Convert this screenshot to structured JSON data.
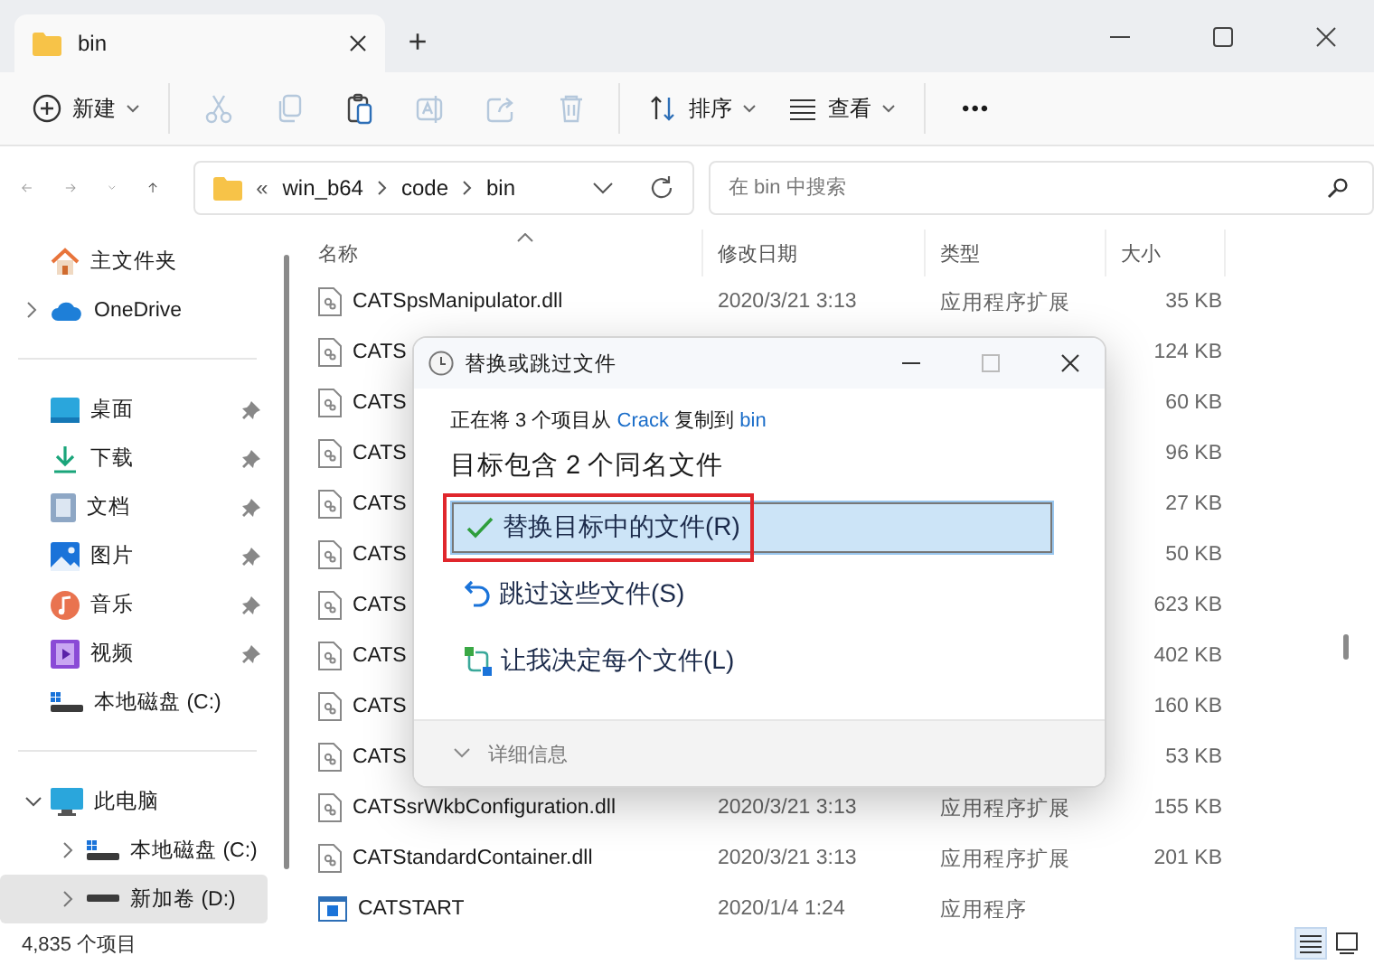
{
  "window": {
    "tabs": [
      {
        "label": "bin",
        "selected": true
      }
    ],
    "new_tab": "+"
  },
  "toolbar": {
    "new": "新建",
    "actions": [
      {
        "kind": "cut",
        "disabled": true
      },
      {
        "kind": "copy",
        "disabled": true
      },
      {
        "kind": "paste",
        "disabled": false
      },
      {
        "kind": "rename",
        "disabled": true
      },
      {
        "kind": "share",
        "disabled": true
      },
      {
        "kind": "delete",
        "disabled": true
      }
    ],
    "sort": "排序",
    "view": "查看",
    "more": "•••"
  },
  "address": {
    "overflow": "«",
    "path": [
      "win_b64",
      "code",
      "bin"
    ],
    "search_placeholder": "在 bin 中搜索"
  },
  "sidebar": {
    "groups": [
      [
        {
          "label": "主文件夹",
          "kind": "home",
          "selected": false
        },
        {
          "label": "OneDrive",
          "kind": "cloud",
          "selected": false,
          "expanded": false
        }
      ],
      [
        {
          "label": "桌面",
          "kind": "desktop",
          "pinned": true,
          "selected": false
        },
        {
          "label": "下载",
          "kind": "download",
          "pinned": true,
          "selected": false
        },
        {
          "label": "文档",
          "kind": "document",
          "pinned": true,
          "selected": false
        },
        {
          "label": "图片",
          "kind": "pictures",
          "pinned": true,
          "selected": false
        },
        {
          "label": "音乐",
          "kind": "music",
          "pinned": true,
          "selected": false
        },
        {
          "label": "视频",
          "kind": "video",
          "pinned": true,
          "selected": false
        },
        {
          "label": "本地磁盘 (C:)",
          "kind": "system-drive",
          "selected": false
        }
      ],
      [
        {
          "label": "此电脑",
          "kind": "computer",
          "selected": false,
          "expanded": true,
          "children": [
            {
              "label": "本地磁盘 (C:)",
              "kind": "system-drive",
              "selected": false,
              "expanded": false
            },
            {
              "label": "新加卷 (D:)",
              "kind": "drive",
              "selected": true,
              "expanded": false
            }
          ]
        }
      ]
    ]
  },
  "table": {
    "columns": [
      "名称",
      "修改日期",
      "类型",
      "大小"
    ],
    "rows": [
      {
        "kind": "dll",
        "name": "CATSpsManipulator.dll",
        "date": "2020/3/21 3:13",
        "type": "应用程序扩展",
        "size": "35 KB"
      },
      {
        "kind": "dll",
        "name": "CATS",
        "size": "124 KB"
      },
      {
        "kind": "dll",
        "name": "CATS",
        "size": "60 KB"
      },
      {
        "kind": "dll",
        "name": "CATS",
        "size": "96 KB"
      },
      {
        "kind": "dll",
        "name": "CATS",
        "size": "27 KB"
      },
      {
        "kind": "dll",
        "name": "CATS",
        "size": "50 KB"
      },
      {
        "kind": "dll",
        "name": "CATS",
        "size": "623 KB"
      },
      {
        "kind": "dll",
        "name": "CATS",
        "size": "402 KB"
      },
      {
        "kind": "dll",
        "name": "CATS",
        "size": "160 KB"
      },
      {
        "kind": "dll",
        "name": "CATS",
        "size": "53 KB"
      },
      {
        "kind": "dll",
        "name": "CATSsrWkbConfiguration.dll",
        "date": "2020/3/21 3:13",
        "type": "应用程序扩展",
        "size": "155 KB"
      },
      {
        "kind": "dll",
        "name": "CATStandardContainer.dll",
        "date": "2020/3/21 3:13",
        "type": "应用程序扩展",
        "size": "201 KB"
      },
      {
        "kind": "exe",
        "name": "CATSTART",
        "date": "2020/1/4 1:24",
        "type": "应用程序"
      }
    ]
  },
  "status_bar": {
    "count": "4,835 个项目",
    "views": [
      {
        "kind": "details",
        "selected": true
      },
      {
        "kind": "tiles",
        "selected": false
      }
    ]
  },
  "dialog": {
    "title": "替换或跳过文件",
    "message": {
      "before": "正在将 3 个项目从",
      "source": "Crack",
      "middle": "复制到",
      "target": "bin"
    },
    "heading": "目标包含 2 个同名文件",
    "options": [
      {
        "kind": "replace",
        "label": "替换目标中的文件(R)",
        "selected": true,
        "highlighted": true
      },
      {
        "kind": "skip",
        "label": "跳过这些文件(S)",
        "selected": false,
        "highlighted": false
      },
      {
        "kind": "decide",
        "label": "让我决定每个文件(L)",
        "selected": false,
        "highlighted": false
      }
    ],
    "details": "详细信息"
  }
}
